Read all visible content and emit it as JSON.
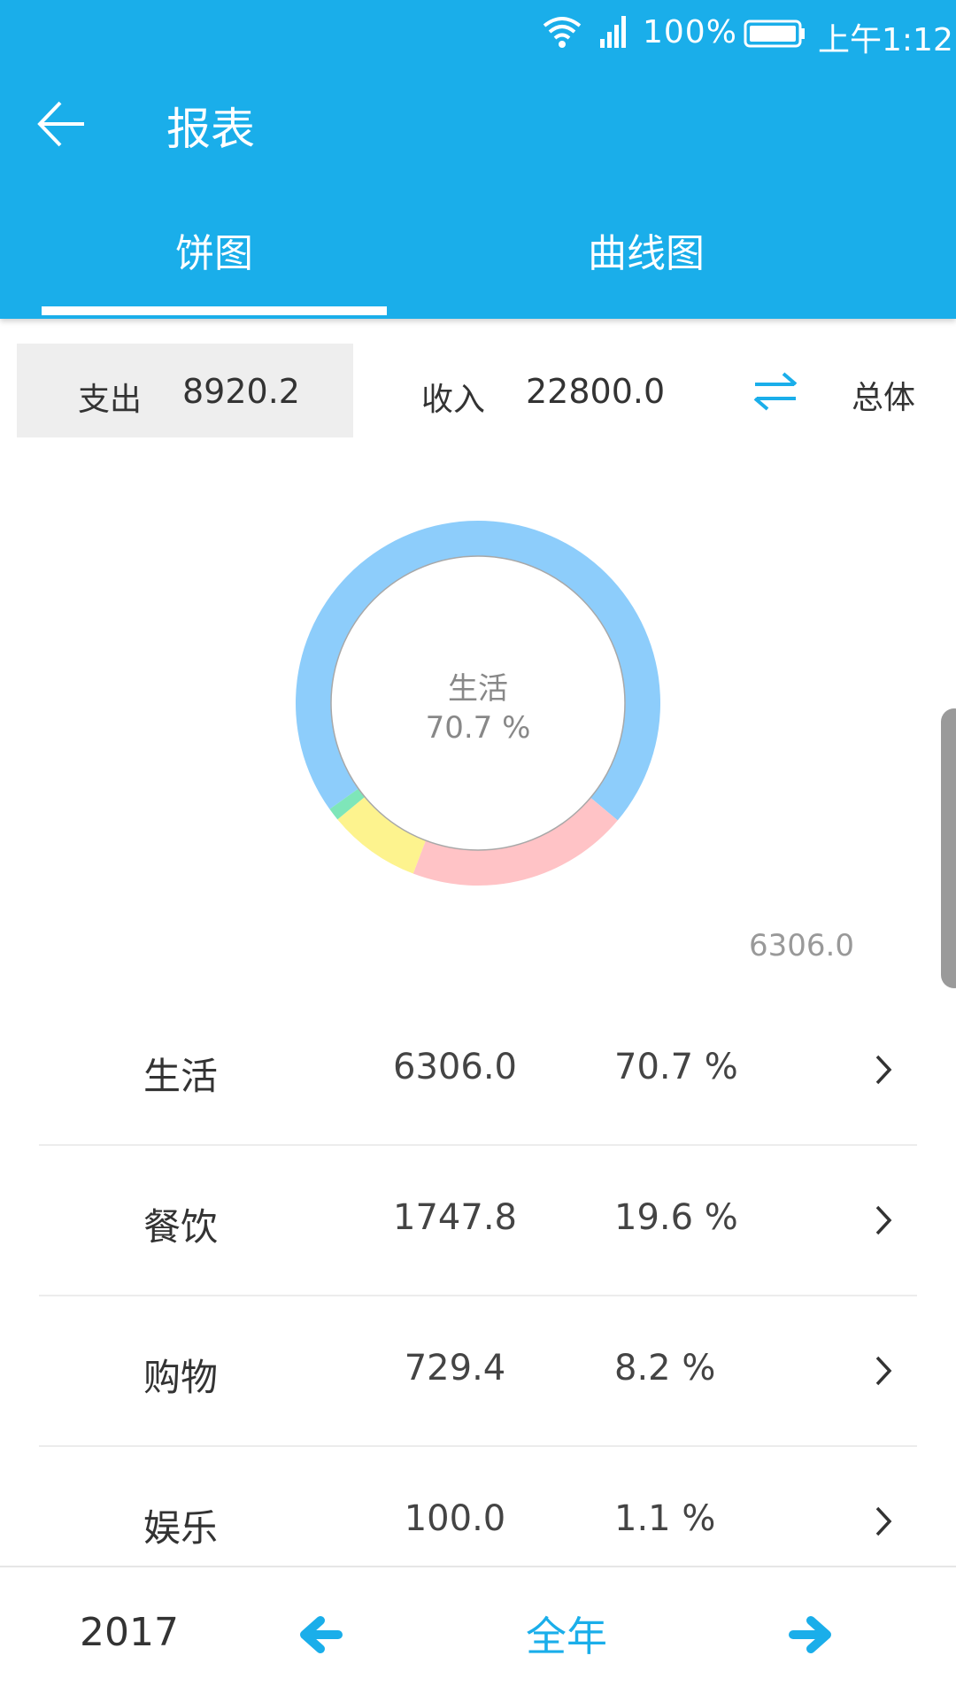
{
  "status_bar": {
    "battery_percent": "100%",
    "time": "上午1:12",
    "icons": [
      "wifi-icon",
      "signal-icon",
      "battery-icon"
    ]
  },
  "header": {
    "title": "报表",
    "back_icon": "arrow-left-icon"
  },
  "tabs": [
    {
      "label": "饼图",
      "active": true
    },
    {
      "label": "曲线图",
      "active": false
    }
  ],
  "summary": {
    "expense_label": "支出",
    "expense_value": "8920.2",
    "income_label": "收入",
    "income_value": "22800.0",
    "swap_icon": "swap-arrows-icon",
    "total_label": "总体",
    "selected": "expense"
  },
  "chart_data": {
    "type": "pie",
    "labels": [
      "生活",
      "餐饮",
      "购物",
      "娱乐"
    ],
    "values": [
      6306.0,
      1747.8,
      729.4,
      100.0
    ],
    "percentages": [
      70.7,
      19.6,
      8.2,
      1.1
    ],
    "colors": [
      "#8dcdfb",
      "#ffc3c6",
      "#fdf38e",
      "#7ee6b9"
    ],
    "center_label": "生活",
    "center_percent": "70.7 %",
    "value_label": "6306.0"
  },
  "list": [
    {
      "name": "生活",
      "amount": "6306.0",
      "percent": "70.7 %"
    },
    {
      "name": "餐饮",
      "amount": "1747.8",
      "percent": "19.6 %"
    },
    {
      "name": "购物",
      "amount": "729.4",
      "percent": "8.2 %"
    },
    {
      "name": "娱乐",
      "amount": "100.0",
      "percent": "1.1 %"
    }
  ],
  "bottom_bar": {
    "year": "2017",
    "period": "全年",
    "prev_icon": "arrow-left-bold-icon",
    "next_icon": "arrow-right-bold-icon"
  },
  "colors": {
    "accent": "#1aaeea",
    "expense_bg": "#eeeeee"
  }
}
